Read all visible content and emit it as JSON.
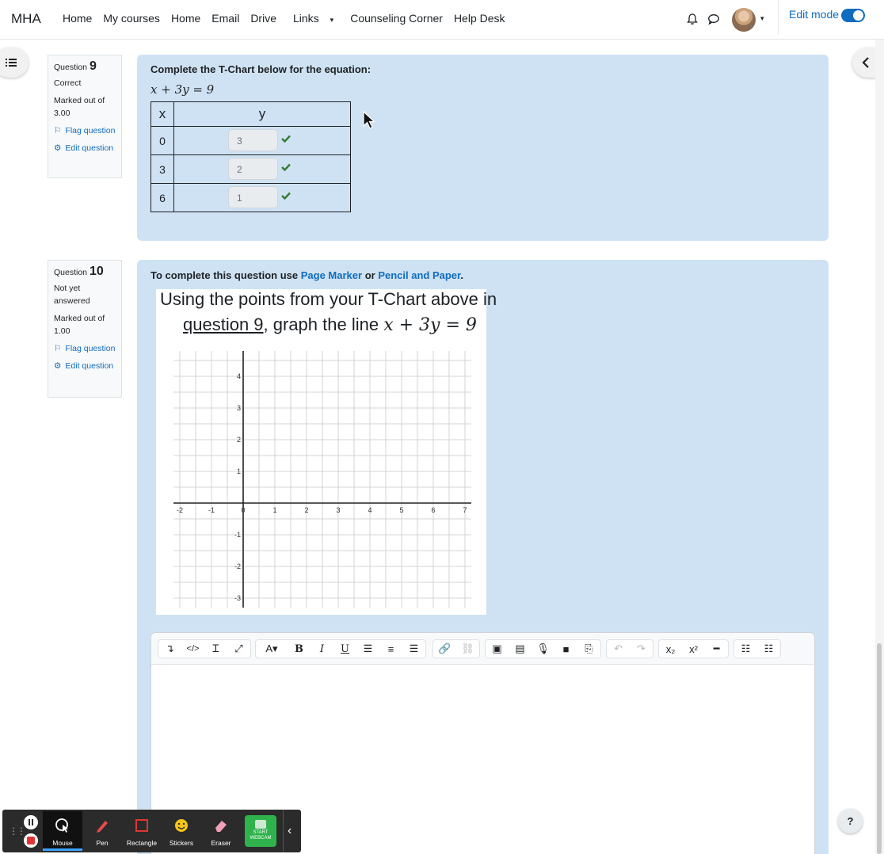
{
  "nav": {
    "brand": "MHA",
    "links": [
      "Home",
      "My courses",
      "Home",
      "Email",
      "Drive",
      "Links",
      "Counseling Corner",
      "Help Desk"
    ],
    "edit_mode_label": "Edit mode",
    "edit_mode_on": true
  },
  "q9": {
    "label": "Question",
    "number": "9",
    "status": "Correct",
    "marked": "Marked out of 3.00",
    "flag": "Flag question",
    "edit": "Edit question",
    "prompt": "Complete the T-Chart below for the equation:",
    "equation": "x + 3y = 9",
    "table_headers": [
      "x",
      "y"
    ],
    "rows": [
      {
        "x": "0",
        "y": "3"
      },
      {
        "x": "3",
        "y": "2"
      },
      {
        "x": "6",
        "y": "1"
      }
    ]
  },
  "q10": {
    "label": "Question",
    "number": "10",
    "status": "Not yet answered",
    "marked": "Marked out of 1.00",
    "flag": "Flag question",
    "edit": "Edit question",
    "instr_prefix": "To complete this question use",
    "link1": "Page Marker",
    "instr_mid": "or",
    "link2": "Pencil and Paper",
    "instr_suffix": ".",
    "img_line1": "Using the points from your T-Chart above in",
    "img_line2_link": "question 9",
    "img_line2_mid": ", graph the line",
    "img_line2_eq": "x + 3y = 9"
  },
  "chart_data": {
    "type": "scatter",
    "xlim": [
      -2.2,
      7.2
    ],
    "ylim": [
      -3.3,
      4.8
    ],
    "x_ticks": [
      "-2",
      "-1",
      "0",
      "1",
      "2",
      "3",
      "4",
      "5",
      "6",
      "7"
    ],
    "y_ticks": [
      "4",
      "3",
      "2",
      "1",
      "-1",
      "-2",
      "-3"
    ],
    "grid": true,
    "series": []
  },
  "editor": {
    "toolbar_icons": [
      "indent-icon",
      "code-icon",
      "text-cursor-icon",
      "fullscreen-icon",
      "font-icon",
      "bold-icon",
      "italic-icon",
      "underline-icon",
      "align-left-icon",
      "align-center-icon",
      "align-right-icon",
      "link-icon",
      "unlink-icon",
      "image-icon",
      "media-icon",
      "microphone-icon",
      "video-icon",
      "copy-icon",
      "undo-icon",
      "redo-icon",
      "subscript-icon",
      "superscript-icon",
      "hr-icon",
      "bullet-list-icon",
      "number-list-icon"
    ]
  },
  "bottom_toolbar": {
    "tools": [
      "Mouse",
      "Pen",
      "Rectangle",
      "Stickers",
      "Eraser"
    ],
    "webcam": "START WEBCAM",
    "accent": "#3ea2ff"
  },
  "help_label": "?"
}
